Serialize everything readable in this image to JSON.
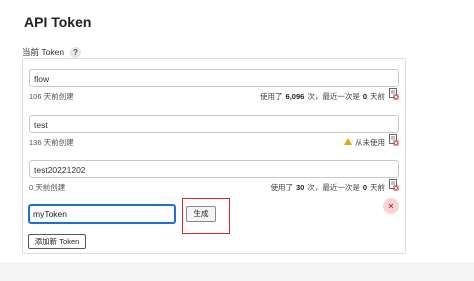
{
  "page": {
    "title": "API Token",
    "section_label": "当前 Token",
    "help_symbol": "?"
  },
  "tokens": [
    {
      "name": "flow",
      "created": "106 天前创建",
      "usage_prefix": "使用了",
      "usage_count": "6,096",
      "usage_mid": "次，最近一次是",
      "last_used_days": "0",
      "usage_suffix": "天前",
      "status": "used"
    },
    {
      "name": "test",
      "created": "136 天前创建",
      "status": "unused",
      "unused_label": "从未使用"
    },
    {
      "name": "test20221202",
      "created": "0 天前创建",
      "usage_prefix": "使用了",
      "usage_count": "30",
      "usage_mid": "次，最近一次是",
      "last_used_days": "0",
      "usage_suffix": "天前",
      "status": "used"
    }
  ],
  "new_token": {
    "value": "myToken",
    "generate_label": "生成",
    "close_symbol": "×"
  },
  "add_button_label": "添加新 Token",
  "colors": {
    "focus_border": "#1e6fd9",
    "highlight_red": "#d9262c",
    "warning": "#e6a700",
    "delete_red": "#d03030"
  }
}
